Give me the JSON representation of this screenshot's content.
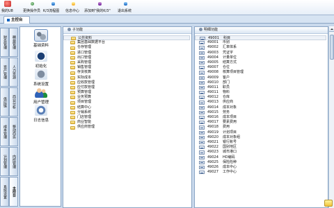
{
  "toolbar": {
    "items": [
      {
        "label": "我的U8",
        "icon": "home-icon"
      },
      {
        "label": "更换操作员",
        "icon": "user-swap-icon"
      },
      {
        "label": "K/3流程图",
        "icon": "flowchart-icon"
      },
      {
        "label": "信息中心",
        "icon": "info-icon"
      },
      {
        "label": "添加到\"我的K/3\"",
        "icon": "add-favorite-icon"
      },
      {
        "label": "退出系统",
        "icon": "exit-icon"
      }
    ]
  },
  "tabs": {
    "active": "主控台"
  },
  "vertical_tabs": {
    "col_a": [
      "财务管理",
      "资产管理",
      "供应链",
      "成本管理",
      "计划管理",
      "系统设置"
    ],
    "col_b": [
      "精益管理",
      "人力资源",
      "商业分析",
      "移动商务",
      "内控管理",
      "主控台"
    ]
  },
  "modules": [
    {
      "label": "基础资料",
      "icon": "gears-icon",
      "selected": true
    },
    {
      "label": "初始化",
      "icon": "init-icon",
      "selected": false
    },
    {
      "label": "系统设置",
      "icon": "system-settings-icon",
      "selected": false
    },
    {
      "label": "用户管理",
      "icon": "users-icon",
      "selected": false
    },
    {
      "label": "日志信息",
      "icon": "log-icon",
      "selected": false
    }
  ],
  "subfunctions": {
    "title": "子功能",
    "items": [
      "公共资料",
      "集团基础数据平台",
      "仓存管理",
      "进口管理",
      "出口管理",
      "采购管理",
      "销售管理",
      "存货核算",
      "实际成本",
      "应收款管理",
      "应付款管理",
      "预算管理",
      "业务预算",
      "项目管理",
      "结算中心",
      "分销系统",
      "门店管理",
      "商业智能",
      "供应商管理"
    ]
  },
  "details": {
    "title": "明细功能",
    "items": [
      {
        "code": "49001",
        "name": "科目"
      },
      {
        "code": "49001",
        "name": "币别"
      },
      {
        "code": "49002",
        "name": "汇率体系"
      },
      {
        "code": "49003",
        "name": "凭证字"
      },
      {
        "code": "49004",
        "name": "计量单位"
      },
      {
        "code": "49005",
        "name": "结算方式"
      },
      {
        "code": "49007",
        "name": "仓位"
      },
      {
        "code": "49008",
        "name": "核算项目管理"
      },
      {
        "code": "49009",
        "name": "客户"
      },
      {
        "code": "49010",
        "name": "部门"
      },
      {
        "code": "49011",
        "name": "职员"
      },
      {
        "code": "49011",
        "name": "物料"
      },
      {
        "code": "49012",
        "name": "仓库"
      },
      {
        "code": "49013",
        "name": "供应商"
      },
      {
        "code": "49014",
        "name": "成本对象"
      },
      {
        "code": "49015",
        "name": "劳务"
      },
      {
        "code": "49016",
        "name": "成本项目"
      },
      {
        "code": "49017",
        "name": "要素费用"
      },
      {
        "code": "49018",
        "name": "费用"
      },
      {
        "code": "49019",
        "name": "计划项目"
      },
      {
        "code": "49020",
        "name": "成本对象组"
      },
      {
        "code": "49021",
        "name": "银行账号"
      },
      {
        "code": "49022",
        "name": "国别地区"
      },
      {
        "code": "49023",
        "name": "城市港口"
      },
      {
        "code": "49024",
        "name": "HD编码"
      },
      {
        "code": "49025",
        "name": "保险险种"
      },
      {
        "code": "49026",
        "name": "成本中心"
      },
      {
        "code": "49027",
        "name": "工作中心"
      }
    ]
  }
}
